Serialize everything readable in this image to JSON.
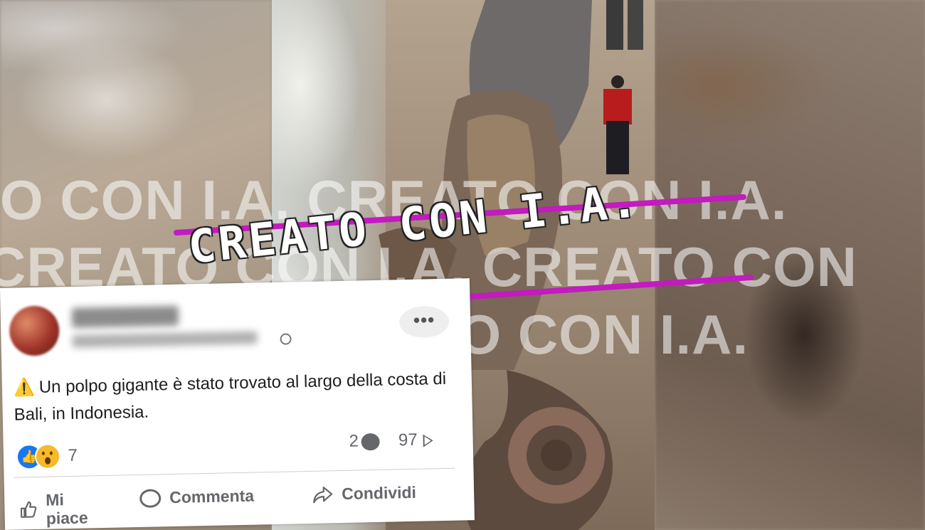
{
  "watermark": {
    "row1": "O CON I.A. CREATO CON I.A.",
    "row2": "CREATO CON I.A. CREATO CON",
    "row3": "CON I.A. CREATO CON I.A."
  },
  "stamp": {
    "text": "CREATO CON I.A.",
    "line_color": "#c21bbf"
  },
  "post": {
    "warning_icon": "⚠️",
    "text": "Un polpo gigante è stato trovato al largo della costa di Bali, in Indonesia.",
    "more_label": "•••",
    "reactions": {
      "icons": [
        "like-icon",
        "wow-icon"
      ],
      "count": "7"
    },
    "comments_count": "2",
    "shares_count": "97",
    "actions": {
      "like": "Mi piace",
      "comment": "Commenta",
      "share": "Condividi"
    }
  },
  "colors": {
    "facebook_blue": "#1877f2",
    "text_dark": "#1c1e21",
    "text_gray": "#65676b"
  }
}
